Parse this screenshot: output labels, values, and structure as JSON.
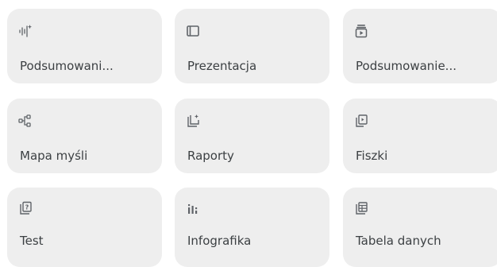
{
  "tiles": [
    {
      "label": "Podsumowani...",
      "icon": "audio-overview-icon"
    },
    {
      "label": "Prezentacja",
      "icon": "slides-icon"
    },
    {
      "label": "Podsumowanie...",
      "icon": "video-overview-icon"
    },
    {
      "label": "Mapa myśli",
      "icon": "mind-map-icon"
    },
    {
      "label": "Raporty",
      "icon": "reports-icon"
    },
    {
      "label": "Fiszki",
      "icon": "flashcards-icon"
    },
    {
      "label": "Test",
      "icon": "quiz-icon"
    },
    {
      "label": "Infografika",
      "icon": "infographic-icon"
    },
    {
      "label": "Tabela danych",
      "icon": "data-table-icon"
    }
  ],
  "colors": {
    "tile_bg": "#eeeeee",
    "text": "#3c4043",
    "icon": "#5f6368"
  }
}
